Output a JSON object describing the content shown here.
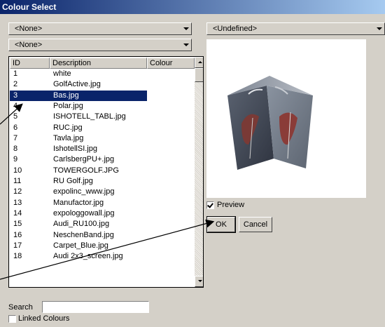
{
  "window": {
    "title": "Colour Select"
  },
  "combos": {
    "left_top": "<None>",
    "left_second": "<None>",
    "right_top": "<Undefined>"
  },
  "table": {
    "headers": [
      "ID",
      "Description",
      "Colour"
    ],
    "selected_id": "3",
    "rows": [
      {
        "id": "1",
        "desc": "white"
      },
      {
        "id": "2",
        "desc": "GolfActive.jpg"
      },
      {
        "id": "3",
        "desc": "Bas.jpg"
      },
      {
        "id": "4",
        "desc": "Polar.jpg"
      },
      {
        "id": "5",
        "desc": "ISHOTELL_TABL.jpg"
      },
      {
        "id": "6",
        "desc": "RUC.jpg"
      },
      {
        "id": "7",
        "desc": "Tavla.jpg"
      },
      {
        "id": "8",
        "desc": "IshotellSI.jpg"
      },
      {
        "id": "9",
        "desc": "CarlsbergPU+.jpg"
      },
      {
        "id": "10",
        "desc": "TOWERGOLF.JPG"
      },
      {
        "id": "11",
        "desc": "RU Golf.jpg"
      },
      {
        "id": "12",
        "desc": "expolinc_www.jpg"
      },
      {
        "id": "13",
        "desc": "Manufactor.jpg"
      },
      {
        "id": "14",
        "desc": "expologgowall.jpg"
      },
      {
        "id": "15",
        "desc": "Audi_RU100.jpg"
      },
      {
        "id": "16",
        "desc": "NeschenBand.jpg"
      },
      {
        "id": "17",
        "desc": "Carpet_Blue.jpg"
      },
      {
        "id": "18",
        "desc": "Audi 2x3_screen.jpg"
      }
    ]
  },
  "preview": {
    "label": "Preview",
    "checked": true
  },
  "buttons": {
    "ok": "OK",
    "cancel": "Cancel"
  },
  "search": {
    "label": "Search",
    "value": ""
  },
  "linked": {
    "label": "Linked Colours",
    "checked": false
  },
  "colors": {
    "titlebar": "#0a246a",
    "selection": "#0a246a",
    "face": "#d4d0c8"
  }
}
